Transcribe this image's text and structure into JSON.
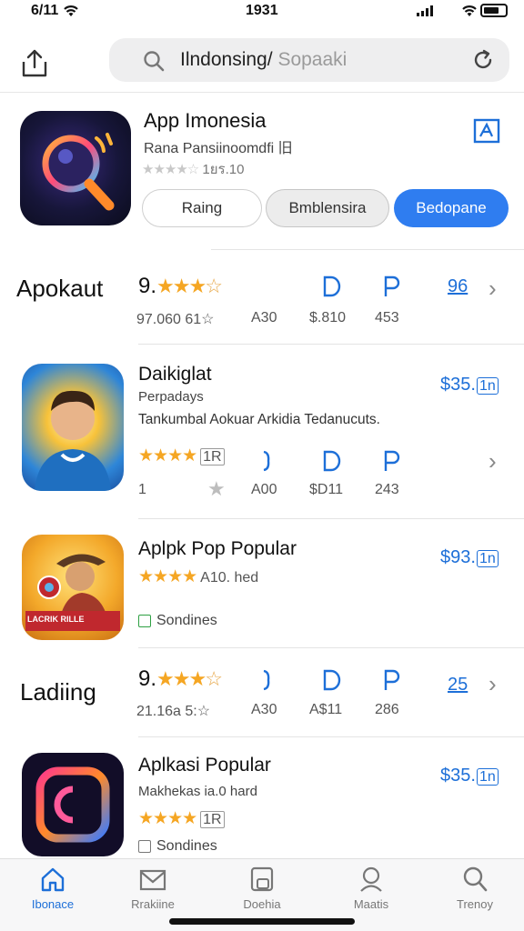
{
  "status_bar": {
    "time_left": "6/11",
    "time_center": "1931"
  },
  "header": {
    "search_query": "Ilndonsing",
    "search_separator": "/",
    "search_placeholder": "Sopaaki",
    "icons": [
      "share-icon",
      "search-icon",
      "refresh-icon"
    ]
  },
  "featured": {
    "title": "App Imonesia",
    "subtitle": "Rana Pansiinoomdfi 旧",
    "rating_text": "1ยร.10",
    "buttons": [
      "Raing",
      "Bmblensira",
      "Bedopane"
    ],
    "accent_color": "#2f7df0"
  },
  "rows": [
    {
      "label": "Apokaut",
      "rating": "9.",
      "stats": [
        "97.060 61☆",
        "A30",
        "$.810",
        "453"
      ],
      "price": "96"
    },
    {
      "title": "Daikiglat",
      "subtitle": "Perpadays",
      "description": "Tankumbal Aokuar Arkidia Tedanucuts.",
      "rating_label": "1R",
      "stats": [
        "1",
        "A00",
        "$D11",
        "243"
      ],
      "price": "$35.",
      "price_box": "1n"
    },
    {
      "title": "Aplpk Pop Popular",
      "rating_label": "A10. hed",
      "status": "Sondines",
      "price": "$93.",
      "price_box": "1n",
      "icon_caption": "LACRIK RILLE"
    },
    {
      "label": "Ladiing",
      "rating": "9.",
      "stats": [
        "21.16a 5:☆",
        "A30",
        "A$11",
        "286"
      ],
      "price": "25"
    },
    {
      "title": "Aplkasi Popular",
      "subtitle": "Makhekas ia.0 hard",
      "rating_label": "1R",
      "status": "Sondines",
      "price": "$35.",
      "price_box": "1n"
    }
  ],
  "tab_bar": {
    "tabs": [
      {
        "label": "Ibonace",
        "icon": "home-icon",
        "active": true
      },
      {
        "label": "Rrakiine",
        "icon": "mail-icon",
        "active": false
      },
      {
        "label": "Doehia",
        "icon": "clipboard-icon",
        "active": false
      },
      {
        "label": "Maatis",
        "icon": "person-search-icon",
        "active": false
      },
      {
        "label": "Trenoy",
        "icon": "search-icon",
        "active": false
      }
    ]
  }
}
